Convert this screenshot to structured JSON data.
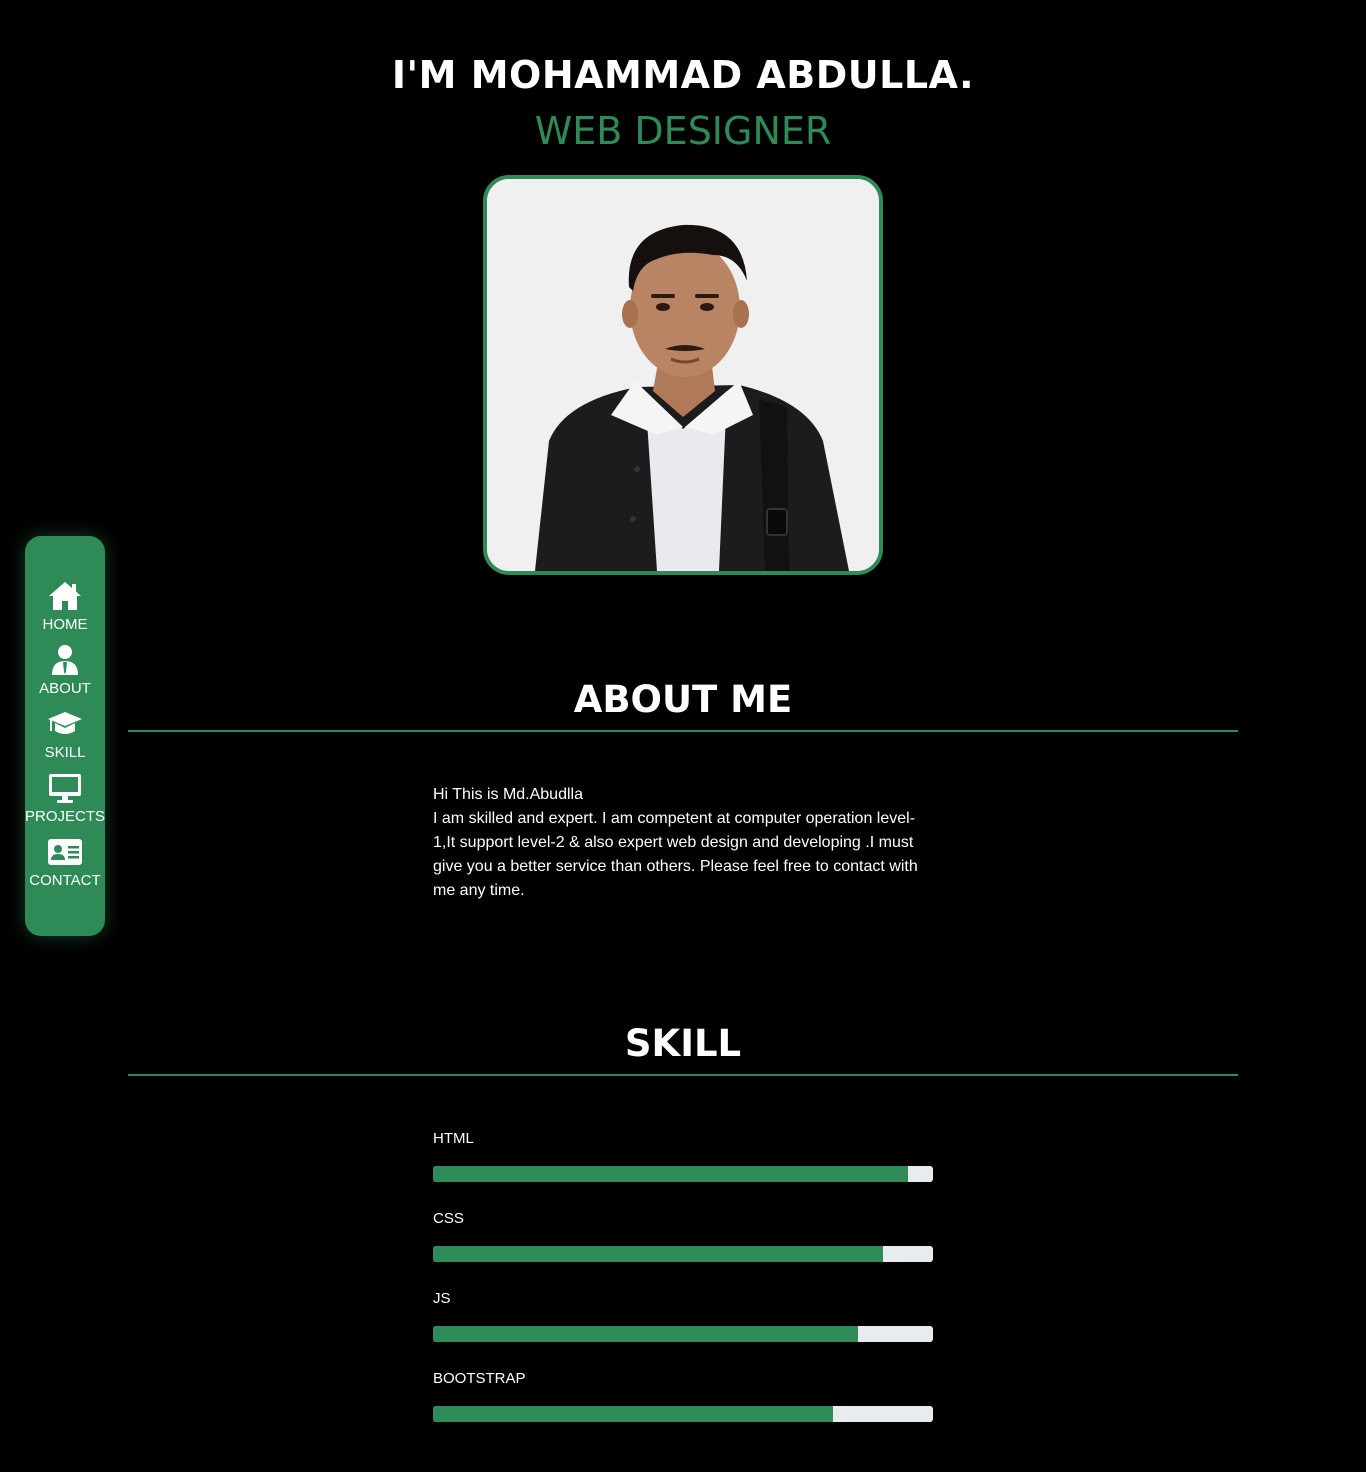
{
  "hero": {
    "name": "I'M MOHAMMAD ABDULLA.",
    "role": "WEB DESIGNER",
    "photo_alt": "Portrait photo"
  },
  "sidebar": {
    "items": [
      {
        "label": "HOME",
        "icon": "home-icon"
      },
      {
        "label": "ABOUT",
        "icon": "user-icon"
      },
      {
        "label": "SKILL",
        "icon": "graduation-cap-icon"
      },
      {
        "label": "PROJECTS",
        "icon": "desktop-icon"
      },
      {
        "label": "CONTACT",
        "icon": "id-card-icon"
      }
    ]
  },
  "about": {
    "title": "ABOUT ME",
    "line1": "Hi This is Md.Abudlla",
    "body": "I am skilled and expert. I am competent at computer operation level-1,It support level-2 & also expert web design and developing .I must give you a better service than others. Please feel free to contact with me any time."
  },
  "skill": {
    "title": "SKILL",
    "items": [
      {
        "label": "HTML",
        "percent": 95
      },
      {
        "label": "CSS",
        "percent": 90
      },
      {
        "label": "JS",
        "percent": 85
      },
      {
        "label": "BOOTSTRAP",
        "percent": 80
      }
    ]
  },
  "colors": {
    "accent": "#2e8b57",
    "background": "#000000",
    "track": "#e9ecef"
  }
}
